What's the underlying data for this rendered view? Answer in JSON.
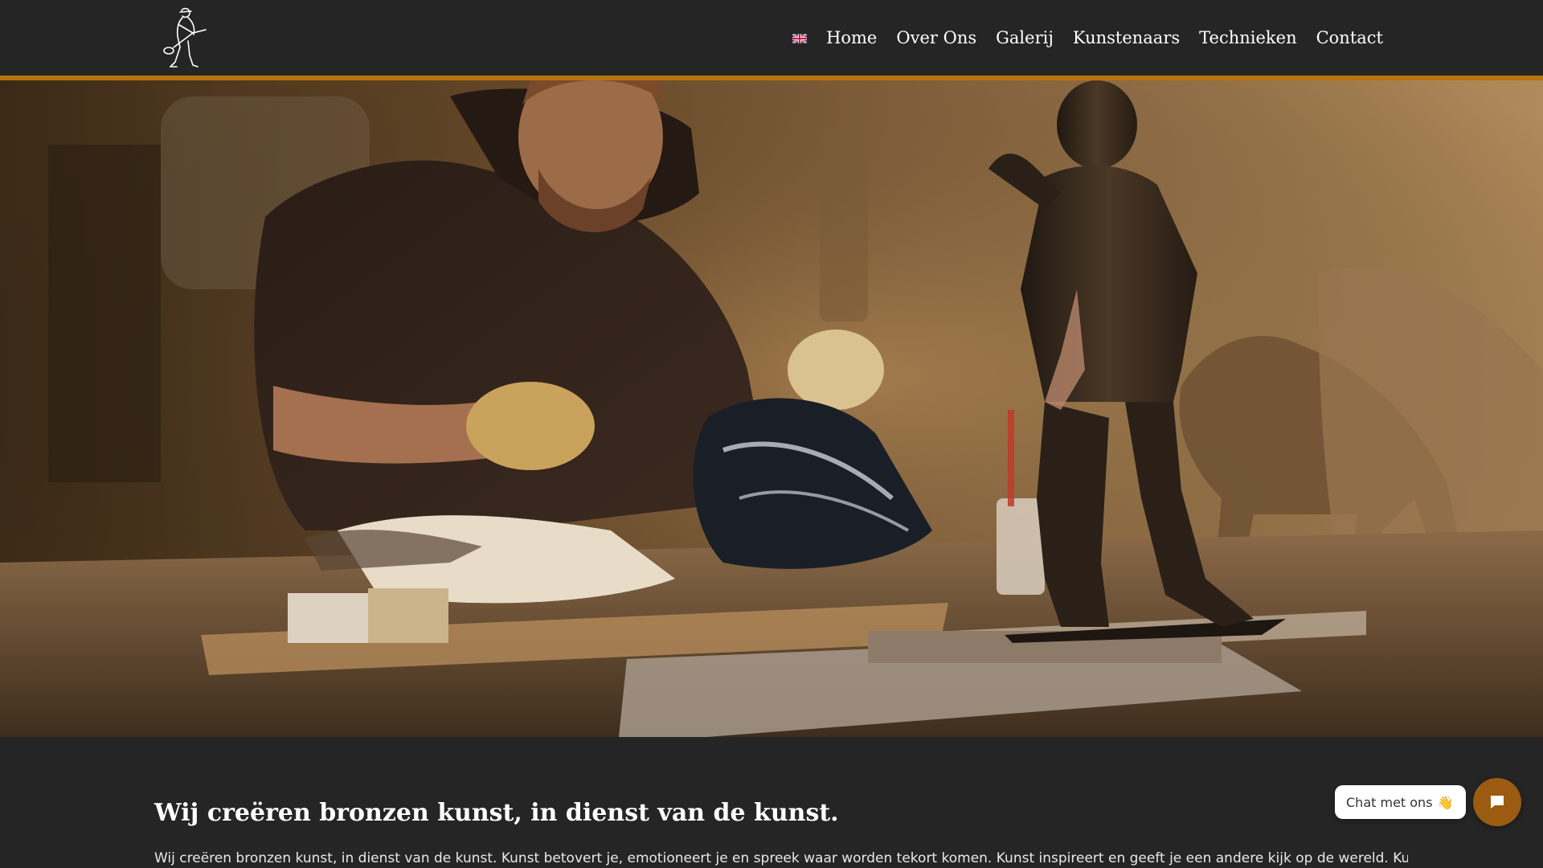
{
  "header": {
    "logo_icon": "foundry-worker-logo",
    "language_flag": "uk-flag-icon",
    "nav": [
      {
        "label": "Home"
      },
      {
        "label": "Over Ons"
      },
      {
        "label": "Galerij"
      },
      {
        "label": "Kunstenaars"
      },
      {
        "label": "Technieken"
      },
      {
        "label": "Contact"
      }
    ]
  },
  "hero": {
    "image": "sculptor-workshop-photo"
  },
  "content": {
    "title": "Wij creëren bronzen kunst, in dienst van de kunst.",
    "text": "Wij creëren bronzen kunst, in dienst van de kunst. Kunst betovert je, emotioneert je en spreek waar worden tekort komen. Kunst inspireert en geeft je een andere kijk op de wereld. Kunst is"
  },
  "chat": {
    "label": "Chat met ons",
    "emoji": "👋",
    "button_icon": "chat-bubble-icon"
  },
  "colors": {
    "background": "#252525",
    "accent": "#b8730f",
    "chat_button": "#9b5b10"
  }
}
